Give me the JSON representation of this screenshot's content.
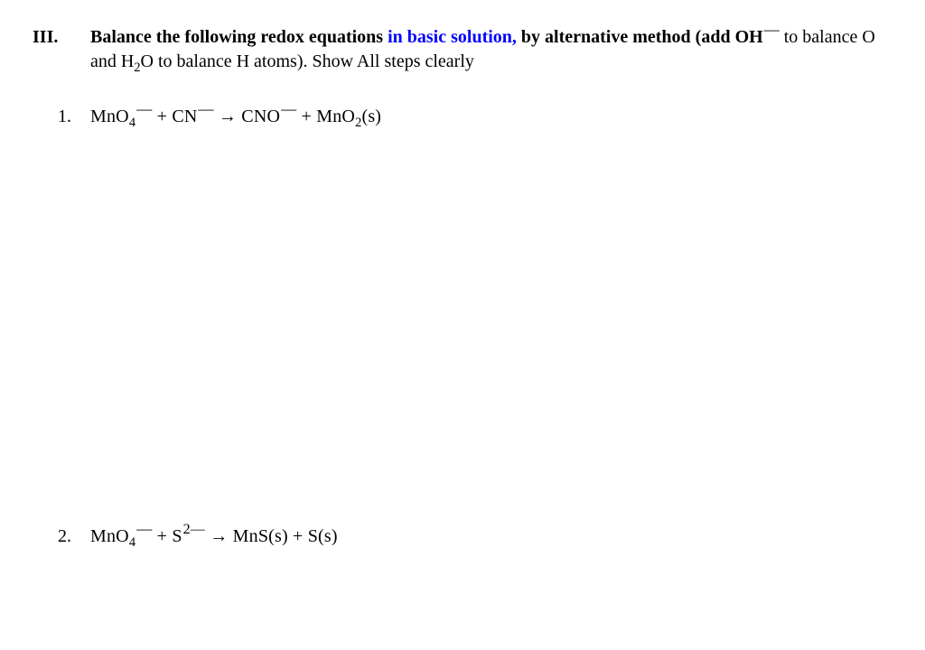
{
  "section": {
    "number": "III.",
    "title_lead": "Balance the following redox equations ",
    "title_blue": "in basic solution,",
    "title_tail": " by alternative method (add OH",
    "title_tail2": " to balance O and H",
    "title_tail3": "O to balance H atoms). Show All steps clearly"
  },
  "q1": {
    "num": "1.",
    "lhs1": "MnO",
    "plus1": "  +  CN",
    "arrow": "  →    CNO",
    "plus2": "  +  MnO",
    "state": "(s)"
  },
  "q2": {
    "num": "2.",
    "lhs1": "MnO",
    "plus1": "    +   S",
    "arrow": "  →  MnS(s)  +  S(s)"
  }
}
